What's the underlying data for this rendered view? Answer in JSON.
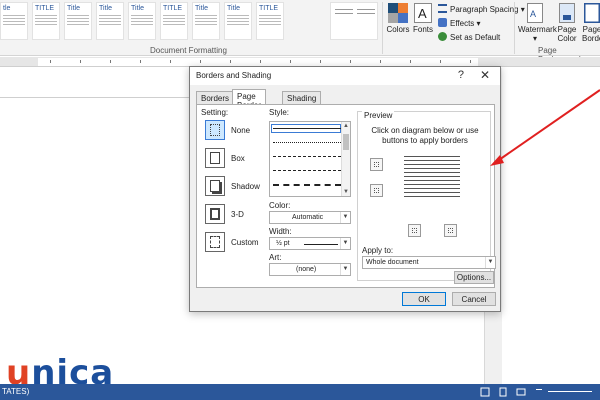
{
  "ribbon": {
    "style_titles": [
      "tle",
      "TITLE",
      "Title",
      "Title",
      "Title",
      "TITLE",
      "Title",
      "Title",
      "TITLE"
    ],
    "document_formatting_label": "Document Formatting",
    "colors_label": "Colors",
    "fonts_label": "Fonts",
    "paragraph_spacing_label": "Paragraph Spacing",
    "effects_label": "Effects",
    "set_as_default_label": "Set as Default",
    "watermark_label": "Watermark",
    "page_color_label": "Page Color",
    "page_borders_label": "Page Borde",
    "page_background_label": "Page Background"
  },
  "dialog": {
    "title": "Borders and Shading",
    "help": "?",
    "close": "✕",
    "tabs": [
      "Borders",
      "Page Border",
      "Shading"
    ],
    "active_tab": "Page Border",
    "setting_label": "Setting:",
    "settings": [
      "None",
      "Box",
      "Shadow",
      "3-D",
      "Custom"
    ],
    "selected_setting": "None",
    "style_label": "Style:",
    "color_label": "Color:",
    "color_value": "Automatic",
    "width_label": "Width:",
    "width_value": "½ pt",
    "art_label": "Art:",
    "art_value": "(none)",
    "preview_label": "Preview",
    "preview_hint": "Click on diagram below or use buttons to apply borders",
    "apply_to_label": "Apply to:",
    "apply_to_value": "Whole document",
    "options_button": "Options...",
    "ok_button": "OK",
    "cancel_button": "Cancel"
  },
  "status": {
    "left_text": "TATES)"
  },
  "logo": {
    "text_first": "u",
    "text_rest": "nica"
  },
  "colors": {
    "ribbon_bg": "#f3f3f3",
    "status_bar": "#2b579a",
    "arrow": "#e02020",
    "logo_blue": "#1c4f9c",
    "logo_accent": "#e04224"
  }
}
